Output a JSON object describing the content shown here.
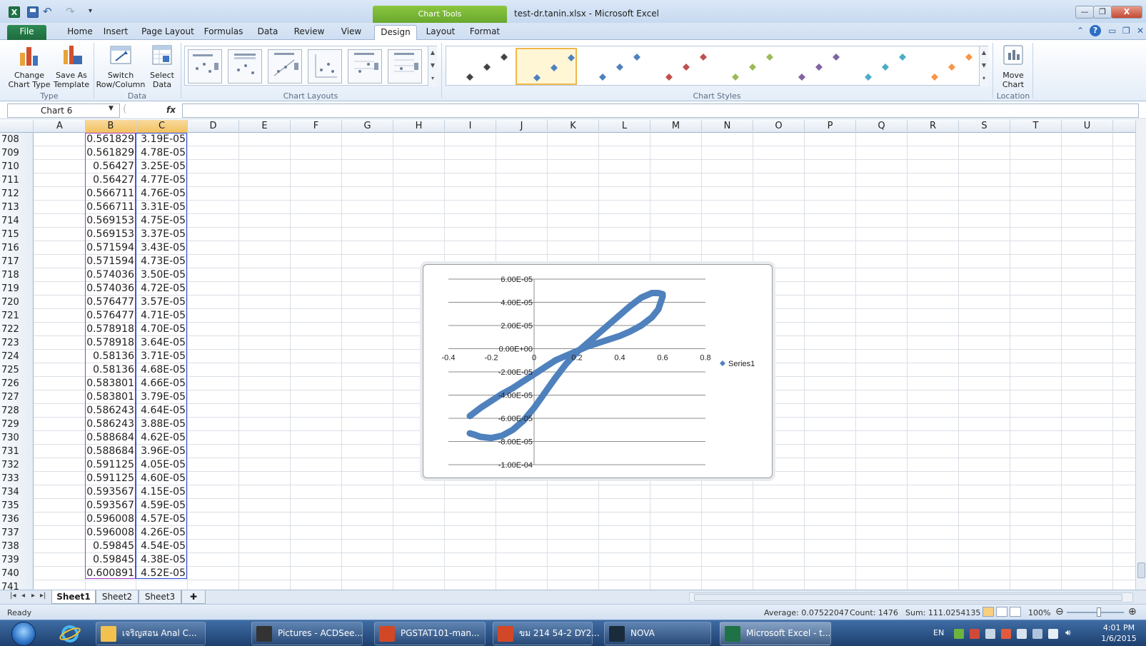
{
  "window": {
    "title": "test-dr.tanin.xlsx - Microsoft Excel",
    "contextual_tab_group": "Chart Tools",
    "close_label": "X",
    "logo_letter": "X"
  },
  "tabs": [
    "File",
    "Home",
    "Insert",
    "Page Layout",
    "Formulas",
    "Data",
    "Review",
    "View",
    "Design",
    "Layout",
    "Format"
  ],
  "active_tab": "Design",
  "ribbon": {
    "type_group": {
      "label": "Type",
      "buttons": [
        {
          "line1": "Change",
          "line2": "Chart Type"
        },
        {
          "line1": "Save As",
          "line2": "Template"
        }
      ]
    },
    "data_group": {
      "label": "Data",
      "buttons": [
        {
          "line1": "Switch",
          "line2": "Row/Column"
        },
        {
          "line1": "Select",
          "line2": "Data"
        }
      ]
    },
    "chart_layouts_label": "Chart Layouts",
    "chart_styles_label": "Chart Styles",
    "style_colors": [
      "#444444",
      "#4f81bd",
      "#4f81bd",
      "#c0504d",
      "#9bbb59",
      "#8064a2",
      "#4bacc6",
      "#f79646"
    ],
    "location_group": {
      "label": "Location",
      "button": {
        "line1": "Move",
        "line2": "Chart"
      }
    }
  },
  "formula_bar": {
    "name_box": "Chart 6",
    "fx": "fx",
    "formula": ""
  },
  "columns": [
    "A",
    "B",
    "C",
    "D",
    "E",
    "F",
    "G",
    "H",
    "I",
    "J",
    "K",
    "L",
    "M",
    "N",
    "O",
    "P",
    "Q",
    "R",
    "S",
    "T",
    "U"
  ],
  "rows": [
    {
      "n": "708",
      "b": "0.561829",
      "c": "3.19E-05"
    },
    {
      "n": "709",
      "b": "0.561829",
      "c": "4.78E-05"
    },
    {
      "n": "710",
      "b": "0.56427",
      "c": "3.25E-05"
    },
    {
      "n": "711",
      "b": "0.56427",
      "c": "4.77E-05"
    },
    {
      "n": "712",
      "b": "0.566711",
      "c": "4.76E-05"
    },
    {
      "n": "713",
      "b": "0.566711",
      "c": "3.31E-05"
    },
    {
      "n": "714",
      "b": "0.569153",
      "c": "4.75E-05"
    },
    {
      "n": "715",
      "b": "0.569153",
      "c": "3.37E-05"
    },
    {
      "n": "716",
      "b": "0.571594",
      "c": "3.43E-05"
    },
    {
      "n": "717",
      "b": "0.571594",
      "c": "4.73E-05"
    },
    {
      "n": "718",
      "b": "0.574036",
      "c": "3.50E-05"
    },
    {
      "n": "719",
      "b": "0.574036",
      "c": "4.72E-05"
    },
    {
      "n": "720",
      "b": "0.576477",
      "c": "3.57E-05"
    },
    {
      "n": "721",
      "b": "0.576477",
      "c": "4.71E-05"
    },
    {
      "n": "722",
      "b": "0.578918",
      "c": "4.70E-05"
    },
    {
      "n": "723",
      "b": "0.578918",
      "c": "3.64E-05"
    },
    {
      "n": "724",
      "b": "0.58136",
      "c": "3.71E-05"
    },
    {
      "n": "725",
      "b": "0.58136",
      "c": "4.68E-05"
    },
    {
      "n": "726",
      "b": "0.583801",
      "c": "4.66E-05"
    },
    {
      "n": "727",
      "b": "0.583801",
      "c": "3.79E-05"
    },
    {
      "n": "728",
      "b": "0.586243",
      "c": "4.64E-05"
    },
    {
      "n": "729",
      "b": "0.586243",
      "c": "3.88E-05"
    },
    {
      "n": "730",
      "b": "0.588684",
      "c": "4.62E-05"
    },
    {
      "n": "731",
      "b": "0.588684",
      "c": "3.96E-05"
    },
    {
      "n": "732",
      "b": "0.591125",
      "c": "4.05E-05"
    },
    {
      "n": "733",
      "b": "0.591125",
      "c": "4.60E-05"
    },
    {
      "n": "734",
      "b": "0.593567",
      "c": "4.15E-05"
    },
    {
      "n": "735",
      "b": "0.593567",
      "c": "4.59E-05"
    },
    {
      "n": "736",
      "b": "0.596008",
      "c": "4.57E-05"
    },
    {
      "n": "737",
      "b": "0.596008",
      "c": "4.26E-05"
    },
    {
      "n": "738",
      "b": "0.59845",
      "c": "4.54E-05"
    },
    {
      "n": "739",
      "b": "0.59845",
      "c": "4.38E-05"
    },
    {
      "n": "740",
      "b": "0.600891",
      "c": "4.52E-05"
    },
    {
      "n": "741",
      "b": "",
      "c": ""
    }
  ],
  "chart_data": {
    "type": "scatter",
    "title": "",
    "xlabel": "",
    "ylabel": "",
    "xlim": [
      -0.4,
      0.8
    ],
    "ylim": [
      -0.0001,
      6e-05
    ],
    "x_ticks": [
      "-0.4",
      "-0.2",
      "0",
      "0.2",
      "0.4",
      "0.6",
      "0.8"
    ],
    "y_ticks": [
      "6.00E-05",
      "4.00E-05",
      "2.00E-05",
      "0.00E+00",
      "-2.00E-05",
      "-4.00E-05",
      "-6.00E-05",
      "-8.00E-05",
      "-1.00E-04"
    ],
    "grid": "horizontal",
    "legend": "right",
    "color": "#4f81bd",
    "series": [
      {
        "name": "Series1",
        "x": [
          -0.3,
          -0.25,
          -0.2,
          -0.15,
          -0.1,
          -0.05,
          0.0,
          0.05,
          0.1,
          0.15,
          0.2,
          0.25,
          0.3,
          0.35,
          0.4,
          0.45,
          0.5,
          0.55,
          0.58,
          0.6,
          0.6,
          0.58,
          0.55,
          0.5,
          0.45,
          0.4,
          0.35,
          0.3,
          0.25,
          0.2,
          0.15,
          0.1,
          0.05,
          0.0,
          -0.05,
          -0.1,
          -0.15,
          -0.2,
          -0.25,
          -0.28,
          -0.3
        ],
        "y": [
          -5.8e-05,
          -5.1e-05,
          -4.5e-05,
          -3.9e-05,
          -3.4e-05,
          -2.8e-05,
          -2.2e-05,
          -1.6e-05,
          -1e-05,
          -6e-06,
          -2e-06,
          2e-06,
          5e-06,
          8e-06,
          1.1e-05,
          1.5e-05,
          2e-05,
          2.7e-05,
          3.4e-05,
          4.5e-05,
          4.7e-05,
          4.8e-05,
          4.8e-05,
          4.4e-05,
          3.7e-05,
          2.9e-05,
          2.1e-05,
          1.3e-05,
          5e-06,
          -3e-06,
          -1.3e-05,
          -2.5e-05,
          -3.8e-05,
          -5.1e-05,
          -6.2e-05,
          -7e-05,
          -7.5e-05,
          -7.7e-05,
          -7.6e-05,
          -7.4e-05,
          -7.3e-05
        ]
      }
    ]
  },
  "sheets": [
    "Sheet1",
    "Sheet2",
    "Sheet3"
  ],
  "active_sheet": "Sheet1",
  "status": {
    "ready": "Ready",
    "average": "Average: 0.07522047",
    "count": "Count: 1476",
    "sum": "Sum: 111.0254135",
    "zoom": "100%"
  },
  "taskbar": {
    "items": [
      {
        "label": "เจริญสอน Anal C...",
        "icon_color": "#f2c14e"
      },
      {
        "label": "Pictures - ACDSee...",
        "icon_color": "#333333"
      },
      {
        "label": "PGSTAT101-man...",
        "icon_color": "#d24726"
      },
      {
        "label": "ขม 214 54-2 DY2...",
        "icon_color": "#d24726"
      },
      {
        "label": "NOVA",
        "icon_color": "#1a2b3c"
      },
      {
        "label": "Microsoft Excel - t...",
        "icon_color": "#1f7245"
      }
    ],
    "lang": "EN",
    "time": "4:01 PM",
    "date": "1/6/2015"
  }
}
